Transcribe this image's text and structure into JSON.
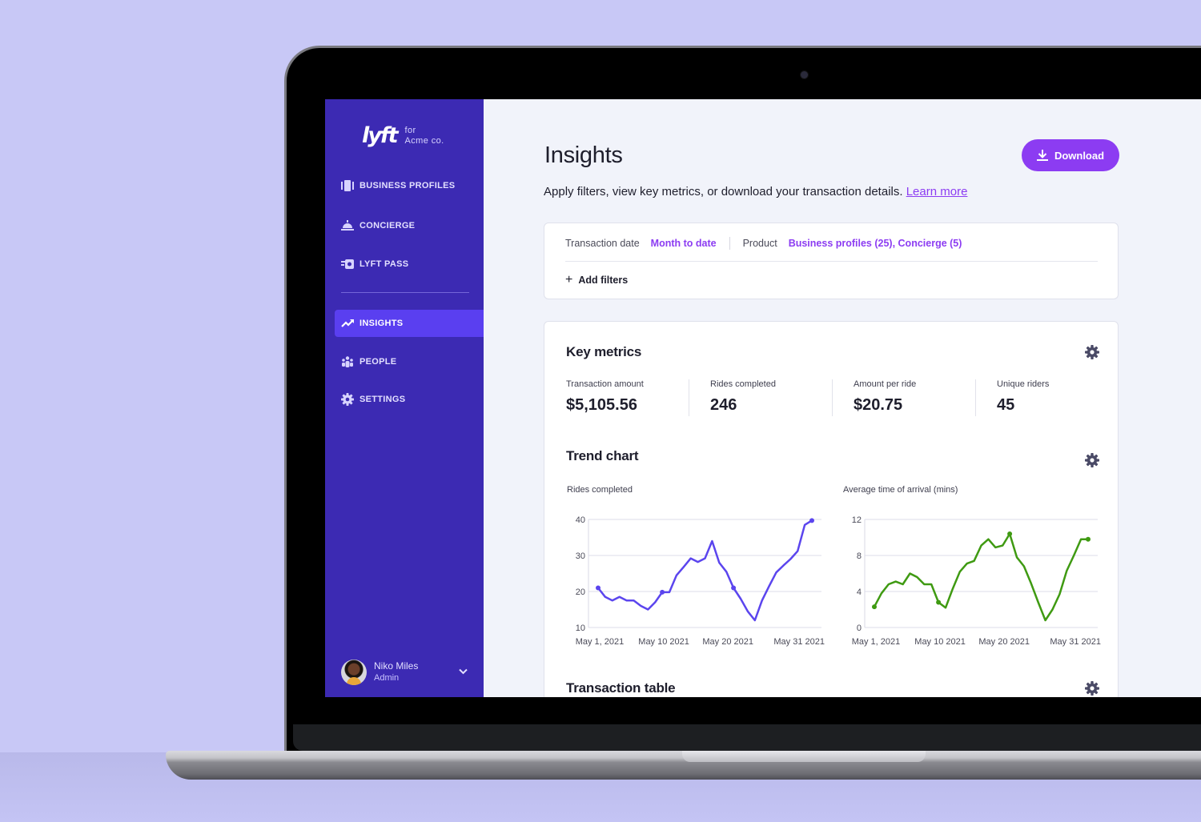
{
  "sidebar": {
    "brand_logo": "lyft",
    "brand_for": "for",
    "brand_org": "Acme co.",
    "items": [
      {
        "label": "BUSINESS PROFILES",
        "icon": "briefcase-icon",
        "active": false
      },
      {
        "label": "CONCIERGE",
        "icon": "concierge-bell-icon",
        "active": false
      },
      {
        "label": "LYFT PASS",
        "icon": "lyft-pass-icon",
        "active": false
      },
      {
        "label": "INSIGHTS",
        "icon": "trending-up-icon",
        "active": true
      },
      {
        "label": "PEOPLE",
        "icon": "people-icon",
        "active": false
      },
      {
        "label": "SETTINGS",
        "icon": "gear-icon",
        "active": false
      }
    ],
    "user": {
      "name": "Niko Miles",
      "role": "Admin"
    }
  },
  "header": {
    "title": "Insights",
    "download_label": "Download",
    "subtitle": "Apply filters, view key metrics, or download your transaction details.",
    "learn_more": "Learn more"
  },
  "filters": {
    "transaction_date_label": "Transaction date",
    "transaction_date_value": "Month to date",
    "product_label": "Product",
    "product_value": "Business profiles (25), Concierge (5)",
    "add_filters_label": "Add filters"
  },
  "key_metrics": {
    "title": "Key metrics",
    "items": [
      {
        "label": "Transaction amount",
        "value": "$5,105.56"
      },
      {
        "label": "Rides completed",
        "value": "246"
      },
      {
        "label": "Amount per ride",
        "value": "$20.75"
      },
      {
        "label": "Unique riders",
        "value": "45"
      }
    ]
  },
  "trend_chart": {
    "title": "Trend chart"
  },
  "transaction_table": {
    "title": "Transaction table"
  },
  "colors": {
    "sidebar_bg": "#3c2ab3",
    "sidebar_active": "#5a3ff0",
    "accent": "#8c3cf2",
    "rides_line": "#5b45ee",
    "arrival_line": "#3f9a12"
  },
  "chart_data": [
    {
      "type": "line",
      "title": "Rides completed",
      "xlabel": "",
      "ylabel": "",
      "ylim": [
        10,
        40
      ],
      "yticks": [
        10,
        20,
        30,
        40
      ],
      "xtick_labels": [
        "May 1, 2021",
        "May 10 2021",
        "May 20 2021",
        "May 31 2021"
      ],
      "xtick_index": [
        0,
        9,
        18,
        28
      ],
      "grid": true,
      "marker_index": [
        0,
        9,
        19,
        30
      ],
      "series": [
        {
          "name": "Rides completed",
          "x": [
            0,
            1,
            2,
            3,
            4,
            5,
            6,
            7,
            8,
            9,
            10,
            11,
            12,
            13,
            14,
            15,
            16,
            17,
            18,
            19,
            20,
            21,
            22,
            23,
            24,
            25,
            26,
            27,
            28,
            29,
            30
          ],
          "values": [
            21,
            18.5,
            17.5,
            18.5,
            17.5,
            17.5,
            16,
            15,
            17,
            19.8,
            19.8,
            24.5,
            26.8,
            29.2,
            28.2,
            29.2,
            34,
            28,
            25.5,
            21,
            18,
            14.5,
            12,
            17.5,
            21.5,
            25.3,
            27.2,
            29,
            31.2,
            38.5,
            39.7
          ]
        }
      ]
    },
    {
      "type": "line",
      "title": "Average time of arrival (mins)",
      "xlabel": "",
      "ylabel": "",
      "ylim": [
        0,
        12
      ],
      "yticks": [
        0,
        4,
        8,
        12
      ],
      "xtick_labels": [
        "May 1, 2021",
        "May 10 2021",
        "May 20 2021",
        "May 31 2021"
      ],
      "xtick_index": [
        0,
        9,
        18,
        28
      ],
      "grid": true,
      "marker_index": [
        0,
        9,
        19,
        30
      ],
      "series": [
        {
          "name": "Average time of arrival",
          "x": [
            0,
            1,
            2,
            3,
            4,
            5,
            6,
            7,
            8,
            9,
            10,
            11,
            12,
            13,
            14,
            15,
            16,
            17,
            18,
            19,
            20,
            21,
            22,
            23,
            24,
            25,
            26,
            27,
            28,
            29,
            30
          ],
          "values": [
            2.3,
            3.8,
            4.8,
            5.1,
            4.8,
            6,
            5.6,
            4.8,
            4.8,
            2.8,
            2.2,
            4.3,
            6.2,
            7.1,
            7.4,
            9.1,
            9.8,
            8.9,
            9.1,
            10.4,
            7.8,
            6.8,
            4.9,
            2.8,
            0.8,
            2,
            3.7,
            6.3,
            8,
            9.8,
            9.8
          ]
        }
      ]
    }
  ]
}
